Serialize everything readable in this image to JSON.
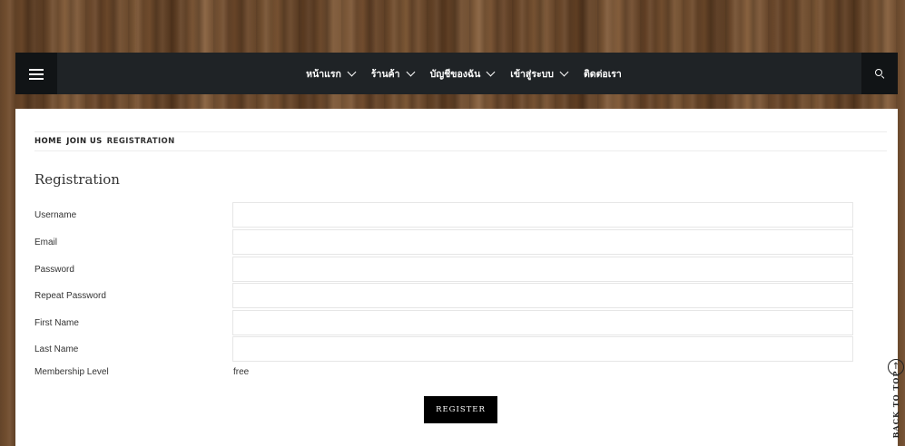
{
  "nav": {
    "items": [
      {
        "label": "หน้าแรก"
      },
      {
        "label": "ร้านค้า"
      },
      {
        "label": "บัญชีของฉัน"
      },
      {
        "label": "เข้าสู่ระบบ"
      },
      {
        "label": "ติดต่อเรา"
      }
    ]
  },
  "breadcrumb": {
    "home": "HOME",
    "join": "JOIN US",
    "current": "REGISTRATION"
  },
  "page": {
    "title": "Registration"
  },
  "form": {
    "fields": [
      {
        "label": "Username",
        "value": ""
      },
      {
        "label": "Email",
        "value": ""
      },
      {
        "label": "Password",
        "value": ""
      },
      {
        "label": "Repeat Password",
        "value": ""
      },
      {
        "label": "First Name",
        "value": ""
      },
      {
        "label": "Last Name",
        "value": ""
      }
    ],
    "membership": {
      "label": "Membership Level",
      "value": "free"
    },
    "submit_label": "REGISTER"
  },
  "back_to_top": {
    "label": "BACK TO TOP",
    "icon": "↑"
  },
  "colors": {
    "navbar": "#1f2326",
    "button": "#000000"
  }
}
